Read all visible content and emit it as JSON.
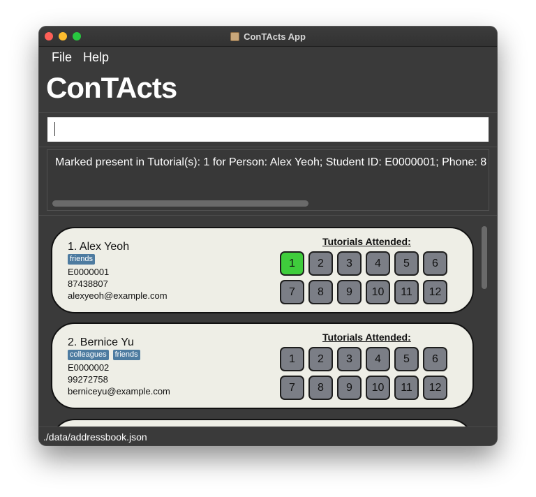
{
  "window": {
    "title": "ConTActs App",
    "app_icon": "address-book-icon",
    "controls": [
      "close-button",
      "minimize-button",
      "zoom-button"
    ]
  },
  "menubar": {
    "file": "File",
    "help": "Help"
  },
  "app": {
    "heading": "ConTActs"
  },
  "command_box": {
    "value": ""
  },
  "result": {
    "text": "Marked present in Tutorial(s): 1 for Person: Alex Yeoh; Student ID: E0000001; Phone: 8"
  },
  "persons": [
    {
      "index_name": "1. Alex Yeoh",
      "tags": [
        "friends"
      ],
      "student_id": "E0000001",
      "phone": "87438807",
      "email": "alexyeoh@example.com",
      "tutorials_label": "Tutorials Attended:",
      "tutorials": [
        "1",
        "2",
        "3",
        "4",
        "5",
        "6",
        "7",
        "8",
        "9",
        "10",
        "11",
        "12"
      ],
      "attended": [
        "1"
      ]
    },
    {
      "index_name": "2. Bernice Yu",
      "tags": [
        "colleagues",
        "friends"
      ],
      "student_id": "E0000002",
      "phone": "99272758",
      "email": "berniceyu@example.com",
      "tutorials_label": "Tutorials Attended:",
      "tutorials": [
        "1",
        "2",
        "3",
        "4",
        "5",
        "6",
        "7",
        "8",
        "9",
        "10",
        "11",
        "12"
      ],
      "attended": []
    }
  ],
  "status_bar": {
    "path": "./data/addressbook.json"
  },
  "colors": {
    "background": "#3a3a3a",
    "card": "#eeeee6",
    "tag": "#4d7ba0",
    "tutorial_attended": "#3fcd3c",
    "tutorial_default": "#7b7e86"
  }
}
